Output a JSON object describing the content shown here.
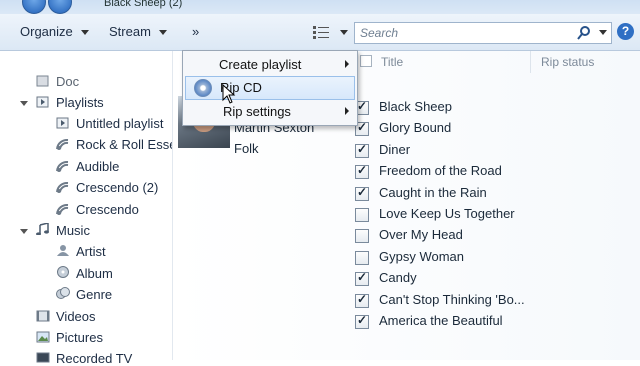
{
  "window": {
    "breadcrumb": "Black Sheep (2)"
  },
  "toolbar": {
    "organize": "Organize",
    "stream": "Stream",
    "more": "»",
    "search_placeholder": "Search",
    "help": "?"
  },
  "sidebar": {
    "items": [
      {
        "label": "Doc",
        "icon": "doc-icon"
      },
      {
        "label": "Playlists",
        "icon": "playlist-icon"
      },
      {
        "label": "Untitled playlist",
        "icon": "playlist-icon"
      },
      {
        "label": "Rock & Roll Esse",
        "icon": "auto-playlist-icon"
      },
      {
        "label": "Audible",
        "icon": "auto-playlist-icon"
      },
      {
        "label": "Crescendo (2)",
        "icon": "auto-playlist-icon"
      },
      {
        "label": "Crescendo",
        "icon": "auto-playlist-icon"
      },
      {
        "label": "Music",
        "icon": "music-icon"
      },
      {
        "label": "Artist",
        "icon": "person-icon"
      },
      {
        "label": "Album",
        "icon": "album-icon"
      },
      {
        "label": "Genre",
        "icon": "genre-icon"
      },
      {
        "label": "Videos",
        "icon": "video-icon"
      },
      {
        "label": "Pictures",
        "icon": "picture-icon"
      },
      {
        "label": "Recorded TV",
        "icon": "tv-icon"
      }
    ]
  },
  "menu": {
    "items": [
      {
        "label": "Create playlist",
        "submenu": true
      },
      {
        "label": "Rip CD",
        "submenu": false,
        "icon": "cd-icon"
      },
      {
        "label": "Rip settings",
        "submenu": true
      }
    ]
  },
  "columns": {
    "title": "Title",
    "rip_status": "Rip status"
  },
  "album": {
    "artist": "Martin Sexton",
    "genre": "Folk"
  },
  "tracks": [
    {
      "title": "Black Sheep",
      "checked": true
    },
    {
      "title": "Glory Bound",
      "checked": true
    },
    {
      "title": "Diner",
      "checked": true
    },
    {
      "title": "Freedom of the Road",
      "checked": true
    },
    {
      "title": "Caught in the Rain",
      "checked": true
    },
    {
      "title": "Love Keep Us Together",
      "checked": false
    },
    {
      "title": "Over My Head",
      "checked": false
    },
    {
      "title": "Gypsy Woman",
      "checked": false
    },
    {
      "title": "Candy",
      "checked": true
    },
    {
      "title": "Can't Stop Thinking 'Bo...",
      "checked": true
    },
    {
      "title": "America the Beautiful",
      "checked": true
    }
  ]
}
